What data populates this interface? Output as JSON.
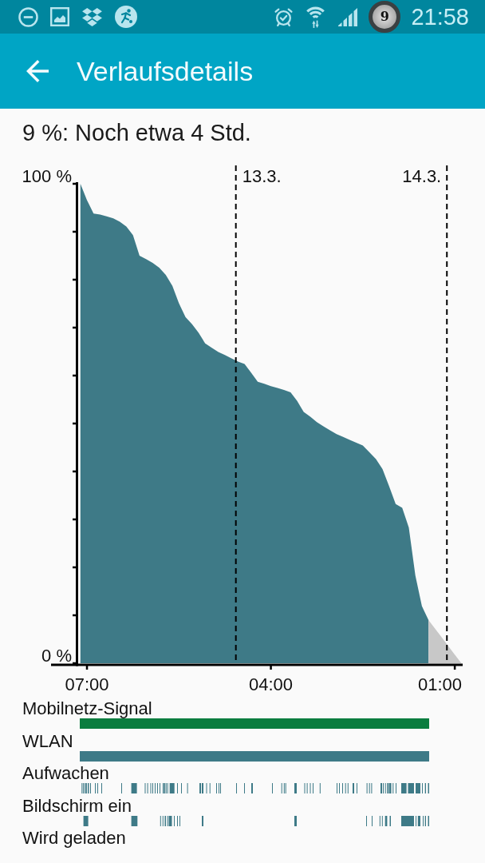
{
  "status_bar": {
    "badge": "9",
    "time": "21:58"
  },
  "app_bar": {
    "title": "Verlaufsdetails"
  },
  "summary": "9 %: Noch etwa 4 Std.",
  "history_chart": {
    "chart_data": {
      "type": "area",
      "categories": [
        null,
        "07:00",
        null,
        null,
        null,
        null,
        null,
        null,
        null,
        null,
        null,
        null,
        null,
        null,
        null,
        null,
        null,
        null,
        null,
        null,
        null,
        null,
        null,
        null,
        null,
        null,
        null,
        null,
        null,
        "04:00",
        null,
        null,
        null,
        null,
        null,
        null,
        null,
        null,
        null,
        null,
        null,
        null,
        null,
        null,
        null,
        null,
        null,
        null,
        null,
        null,
        null,
        null,
        null,
        null,
        null,
        null,
        null,
        "01:00",
        null
      ],
      "series": [
        {
          "color": "#3e7a87",
          "values": [
            100,
            96.6,
            93.8,
            93.6,
            93.2,
            92.8,
            92.1,
            91.1,
            89.3,
            85,
            84.3,
            83.5,
            82.5,
            81,
            78.7,
            75.1,
            72.2,
            70.7,
            68.9,
            66.7,
            65.8,
            64.9,
            64.3,
            63.6,
            62.9,
            62.4,
            60.6,
            58.7,
            58.3,
            57.8,
            57.4,
            57,
            56.5,
            54.7,
            52.4,
            51.4,
            50.3,
            49.4,
            48.6,
            47.8,
            47.2,
            46.6,
            46,
            45.4,
            44,
            42.6,
            40.5,
            36.9,
            33.2,
            32.4,
            28.3,
            18.3,
            11.9,
            9,
            null,
            null,
            null,
            null,
            null
          ]
        },
        {
          "color": "#c8c8c8",
          "values": [
            null,
            null,
            null,
            null,
            null,
            null,
            null,
            null,
            null,
            null,
            null,
            null,
            null,
            null,
            null,
            null,
            null,
            null,
            null,
            null,
            null,
            null,
            null,
            null,
            null,
            null,
            null,
            null,
            null,
            null,
            null,
            null,
            null,
            null,
            null,
            null,
            null,
            null,
            null,
            null,
            null,
            null,
            null,
            null,
            null,
            null,
            null,
            null,
            null,
            null,
            null,
            null,
            null,
            9,
            7.2,
            5.4,
            3.6,
            1.8,
            0
          ]
        }
      ],
      "ylim": [
        0,
        100
      ],
      "yticks": [
        {
          "value": 0,
          "label": "0 %"
        },
        {
          "value": 100,
          "label": "100 %"
        }
      ],
      "annotations": [
        "13.3.",
        "14.3."
      ]
    }
  },
  "tracks": [
    {
      "label": "Mobilnetz-Signal",
      "kind": "bar",
      "color": "#0a7d3f"
    },
    {
      "label": "WLAN",
      "kind": "bar",
      "color": "#3e7a87"
    },
    {
      "label": "Aufwachen",
      "kind": "ticks",
      "color": "#3e7a87"
    },
    {
      "label": "Bildschirm ein",
      "kind": "ticks",
      "color": "#3e7a87"
    },
    {
      "label": "Wird geladen"
    }
  ]
}
